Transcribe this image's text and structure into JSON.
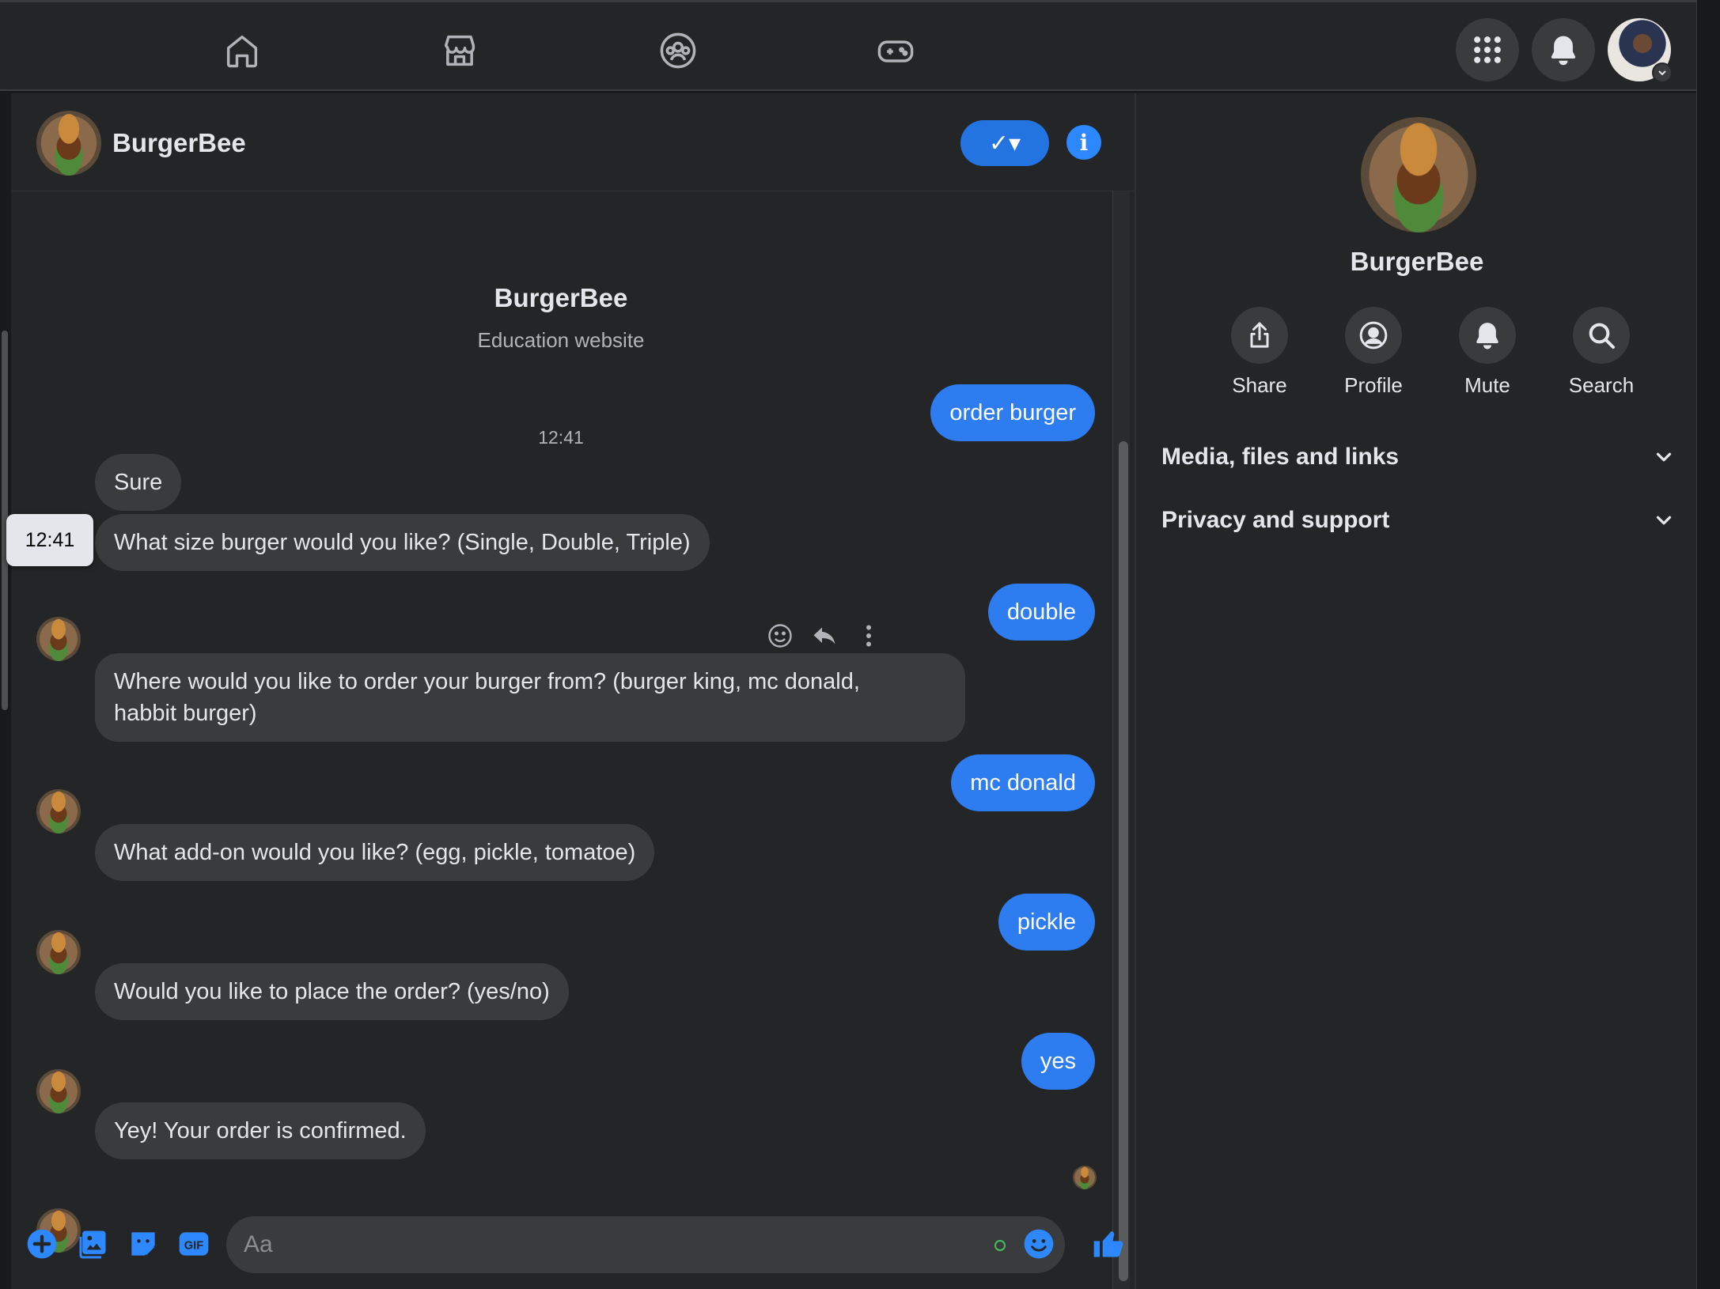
{
  "nav": {
    "tabs": [
      {
        "name": "home",
        "icon": "home-icon"
      },
      {
        "name": "marketplace",
        "icon": "store-icon"
      },
      {
        "name": "groups",
        "icon": "groups-icon"
      },
      {
        "name": "gaming",
        "icon": "gamepad-icon"
      }
    ],
    "actions": [
      "menu-grid-icon",
      "bell-icon",
      "account-avatar"
    ]
  },
  "chat": {
    "contact_name": "BurgerBee",
    "intro": {
      "name": "BurgerBee",
      "subtitle": "Education website"
    },
    "timestamp": "12:41",
    "hover_timestamp": "12:41",
    "composer_placeholder": "Aa",
    "messages": [
      {
        "from": "me",
        "text": "order burger"
      },
      {
        "from": "bot",
        "text": "Sure"
      },
      {
        "from": "bot",
        "text": "What size burger would you like? (Single, Double, Triple)"
      },
      {
        "from": "me",
        "text": "double"
      },
      {
        "from": "bot",
        "text": "Where would you like to order your burger from? (burger king, mc donald,"
      },
      {
        "from": "bot",
        "text": "habbit burger)"
      },
      {
        "from": "me",
        "text": "mc donald"
      },
      {
        "from": "bot",
        "text": "What add-on would you like? (egg, pickle, tomatoe)"
      },
      {
        "from": "me",
        "text": "pickle"
      },
      {
        "from": "bot",
        "text": "Would you like to place the order? (yes/no)"
      },
      {
        "from": "me",
        "text": "yes"
      },
      {
        "from": "bot",
        "text": "Yey! Your order is confirmed."
      }
    ]
  },
  "sidebar": {
    "name": "BurgerBee",
    "actions": [
      {
        "label": "Share",
        "icon": "share-icon"
      },
      {
        "label": "Profile",
        "icon": "profile-icon"
      },
      {
        "label": "Mute",
        "icon": "bell-icon"
      },
      {
        "label": "Search",
        "icon": "search-icon"
      }
    ],
    "sections": [
      {
        "label": "Media, files and links"
      },
      {
        "label": "Privacy and support"
      }
    ]
  },
  "colors": {
    "accent": "#2d88ff",
    "outgoing_bubble": "#2d7cf0",
    "incoming_bubble": "#3a3b3c",
    "panel": "#242526",
    "background": "#18191a"
  }
}
